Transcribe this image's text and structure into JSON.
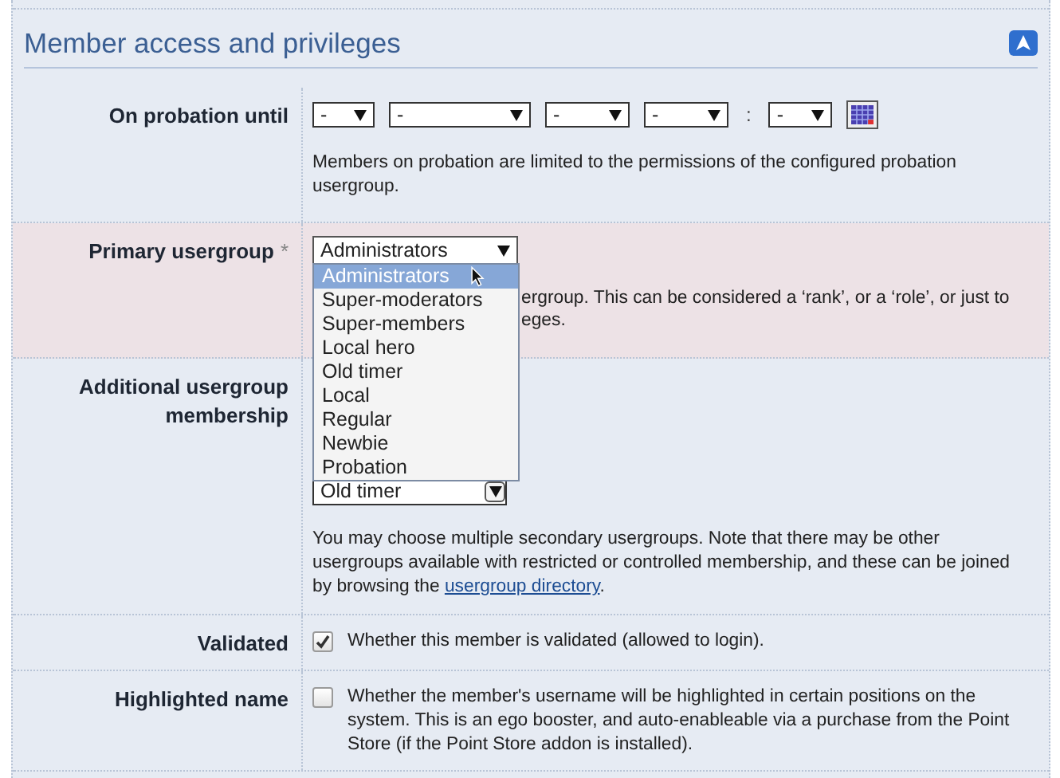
{
  "section": {
    "title": "Member access and privileges"
  },
  "probation": {
    "label": "On probation until",
    "selects": [
      "-",
      "-",
      "-",
      "-",
      "-"
    ],
    "separator": ":",
    "description": "Members on probation are limited to the permissions of the configured probation usergroup."
  },
  "primary_usergroup": {
    "label": "Primary usergroup",
    "required_mark": "*",
    "value": "Administrators",
    "expanded": true,
    "options": [
      {
        "label": "Administrators",
        "selected": true
      },
      {
        "label": "Super-moderators",
        "selected": false
      },
      {
        "label": "Super-members",
        "selected": false
      },
      {
        "label": "Local hero",
        "selected": false
      },
      {
        "label": "Old timer",
        "selected": false
      },
      {
        "label": "Local",
        "selected": false
      },
      {
        "label": "Regular",
        "selected": false
      },
      {
        "label": "Newbie",
        "selected": false
      },
      {
        "label": "Probation",
        "selected": false
      }
    ],
    "description_lines": [
      "ergroup. This can be considered a ‘rank’, or a ‘role’, or just to",
      "eges."
    ]
  },
  "additional_usergroups": {
    "label": "Additional usergroup membership",
    "visible_option": "Old timer",
    "description": "You may choose multiple secondary usergroups. Note that there may be other usergroups available with restricted or controlled membership, and these can be joined by browsing the ",
    "link": "usergroup directory",
    "description_end": "."
  },
  "validated": {
    "label": "Validated",
    "checked": true,
    "description": "Whether this member is validated (allowed to login)."
  },
  "highlighted_name": {
    "label": "Highlighted name",
    "checked": false,
    "description": "Whether the member's username will be highlighted in certain positions on the system. This is an ego booster, and auto-enableable via a purchase from the Point Store (if the Point Store addon is installed)."
  }
}
